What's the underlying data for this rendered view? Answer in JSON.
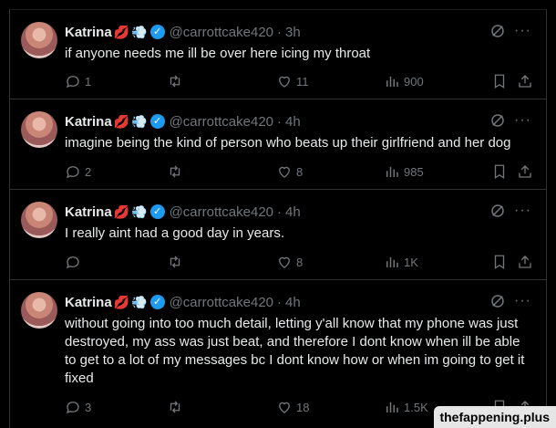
{
  "tweets": [
    {
      "name": "Katrina",
      "emoji_lips": "💋",
      "emoji_dash": "💨",
      "handle": "@carrottcake420",
      "separator": "·",
      "time": "3h",
      "text": "if anyone needs me ill be over here icing my throat",
      "replies": "1",
      "retweets": "",
      "likes": "11",
      "views": "900"
    },
    {
      "name": "Katrina",
      "emoji_lips": "💋",
      "emoji_dash": "💨",
      "handle": "@carrottcake420",
      "separator": "·",
      "time": "4h",
      "text": "imagine being the kind of person who beats up their girlfriend and her dog",
      "replies": "2",
      "retweets": "",
      "likes": "8",
      "views": "985"
    },
    {
      "name": "Katrina",
      "emoji_lips": "💋",
      "emoji_dash": "💨",
      "handle": "@carrottcake420",
      "separator": "·",
      "time": "4h",
      "text": "I really aint had a good day in years.",
      "replies": "",
      "retweets": "",
      "likes": "8",
      "views": "1K"
    },
    {
      "name": "Katrina",
      "emoji_lips": "💋",
      "emoji_dash": "💨",
      "handle": "@carrottcake420",
      "separator": "·",
      "time": "4h",
      "text": "without going into too much detail, letting y'all know that my phone was just destroyed, my ass was just beat, and therefore I dont know when ill be able to get to a lot of my messages bc I dont know how or when im going to get it fixed",
      "replies": "3",
      "retweets": "",
      "likes": "18",
      "views": "1.5K"
    }
  ],
  "verified_mark": "✓",
  "more_glyph": "···",
  "watermark": "thefappening.plus",
  "colors": {
    "background": "#000000",
    "text": "#e7e9ea",
    "muted": "#71767b",
    "border": "#2f3336",
    "verified": "#1d9bf0"
  },
  "icons": [
    "reply-icon",
    "retweet-icon",
    "like-icon",
    "views-icon",
    "bookmark-icon",
    "share-icon",
    "grok-icon",
    "more-icon",
    "verified-badge-icon"
  ]
}
